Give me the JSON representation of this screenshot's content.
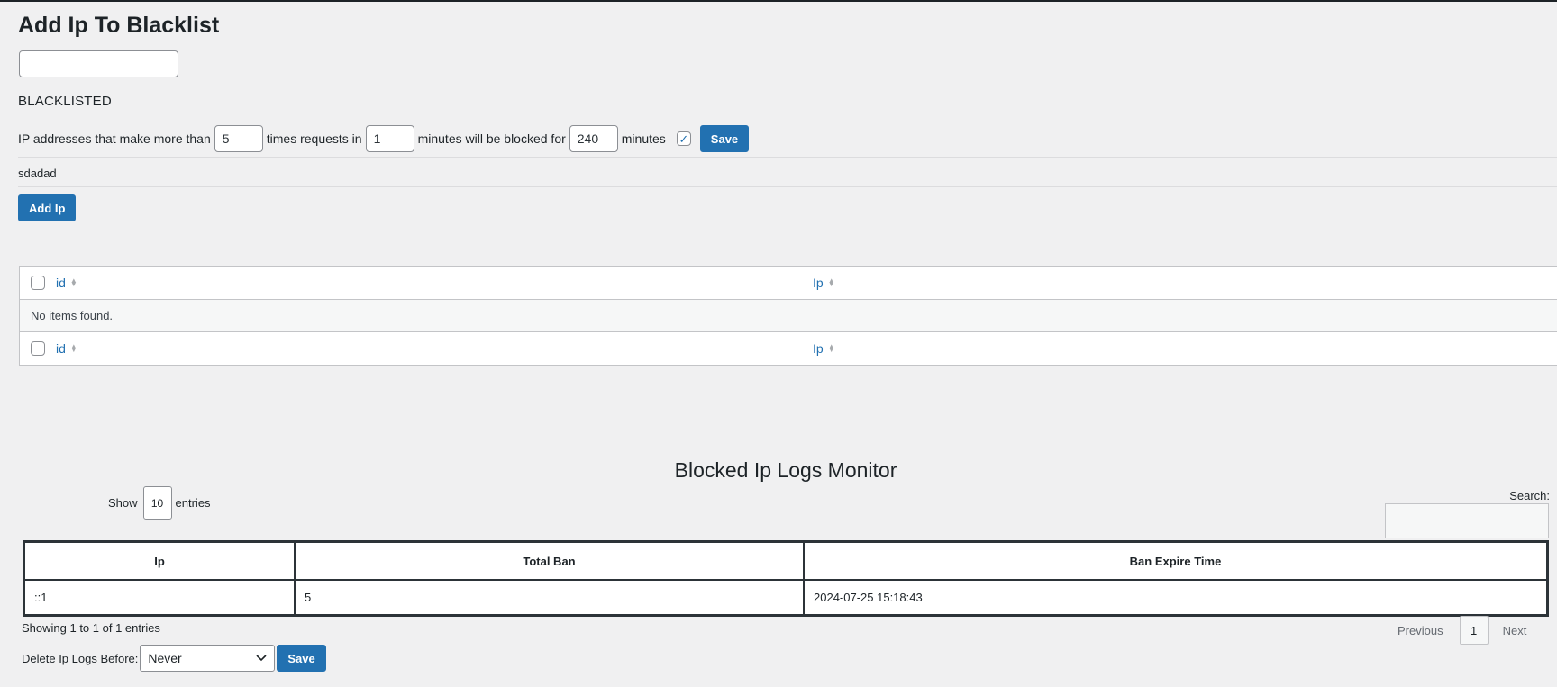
{
  "header": {
    "title": "Add Ip To Blacklist"
  },
  "add_form": {
    "ip_value": ""
  },
  "blacklisted": {
    "heading": "BLACKLISTED",
    "rule_prefix": "IP addresses that make more than",
    "requests_value": "5",
    "rule_mid1": "times requests in",
    "minutes_value": "1",
    "rule_mid2": "minutes will be blocked for",
    "block_value": "240",
    "rule_suffix": "minutes",
    "enabled_check": "✓",
    "save_label": "Save",
    "entry": "sdadad",
    "add_label": "Add Ip"
  },
  "ip_table": {
    "col_id": "id",
    "col_ip": "Ip",
    "empty_message": "No items found."
  },
  "monitor": {
    "title": "Blocked Ip Logs Monitor",
    "show_label": "Show",
    "length_value": "10",
    "entries_label": "entries",
    "search_label": "Search:",
    "columns": [
      "Ip",
      "Total Ban",
      "Ban Expire Time"
    ],
    "rows": [
      [
        "::1",
        "5",
        "2024-07-25 15:18:43"
      ]
    ],
    "info": "Showing 1 to 1 of 1 entries",
    "previous_label": "Previous",
    "current_page": "1",
    "next_label": "Next",
    "delete_label": "Delete Ip Logs Before:",
    "delete_value": "Never",
    "delete_save_label": "Save"
  }
}
